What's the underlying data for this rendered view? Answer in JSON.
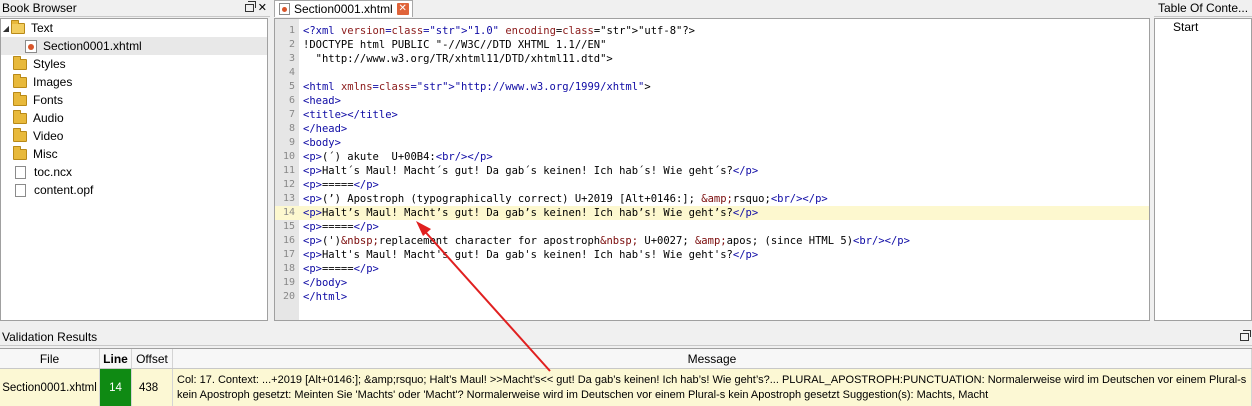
{
  "book_browser": {
    "title": "Book Browser",
    "items": [
      {
        "label": "Text",
        "kind": "folder-open"
      },
      {
        "label": "Section0001.xhtml",
        "kind": "xhtml-file"
      },
      {
        "label": "Styles",
        "kind": "folder"
      },
      {
        "label": "Images",
        "kind": "folder"
      },
      {
        "label": "Fonts",
        "kind": "folder"
      },
      {
        "label": "Audio",
        "kind": "folder"
      },
      {
        "label": "Video",
        "kind": "folder"
      },
      {
        "label": "Misc",
        "kind": "folder"
      },
      {
        "label": "toc.ncx",
        "kind": "file"
      },
      {
        "label": "content.opf",
        "kind": "file"
      }
    ]
  },
  "editor": {
    "tab_label": "Section0001.xhtml",
    "current_line": 14,
    "lines": [
      "<?xml version=\"1.0\" encoding=\"utf-8\"?>",
      "<!DOCTYPE html PUBLIC \"-//W3C//DTD XHTML 1.1//EN\"",
      "  \"http://www.w3.org/TR/xhtml11/DTD/xhtml11.dtd\">",
      "",
      "<html xmlns=\"http://www.w3.org/1999/xhtml\">",
      "<head>",
      "<title></title>",
      "</head>",
      "<body>",
      "<p>(´) akute  U+00B4:<br/></p>",
      "<p>Halt´s Maul! Macht´s gut! Da gab´s keinen! Ich hab´s! Wie geht´s?</p>",
      "<p>=====</p>",
      "<p>(’) Apostroph (typographically correct) U+2019 [Alt+0146:]; &amp;rsquo;<br/></p>",
      "<p>Halt’s Maul! Macht’s gut! Da gab’s keinen! Ich hab’s! Wie geht’s?</p>",
      "<p>=====</p>",
      "<p>(')&nbsp;replacement character for apostroph&nbsp; U+0027; &amp;apos; (since HTML 5)<br/></p>",
      "<p>Halt's Maul! Macht's gut! Da gab's keinen! Ich hab's! Wie geht's?</p>",
      "<p>=====</p>",
      "</body>",
      "</html>"
    ]
  },
  "toc": {
    "title": "Table Of Conte...",
    "items": [
      "Start"
    ]
  },
  "validation": {
    "title": "Validation Results",
    "columns": [
      "File",
      "Line",
      "Offset",
      "Message"
    ],
    "rows": [
      {
        "file": "Section0001.xhtml",
        "line": "14",
        "offset": "438",
        "message": "Col: 17. Context: ...+2019 [Alt+0146:]; &amp;rsquo;  Halt’s Maul! >>Macht’s<< gut! Da gab’s keinen! Ich hab’s! Wie geht’s?... PLURAL_APOSTROPH:PUNCTUATION: Normalerweise wird im Deutschen vor einem Plural-s kein Apostroph gesetzt: Meinten Sie 'Machts' oder 'Macht'? Normalerweise wird im Deutschen vor einem Plural-s kein Apostroph gesetzt Suggestion(s): Machts, Macht"
      }
    ]
  },
  "colors": {
    "line_badge": "#0f8a13",
    "highlight_row": "#fcf8d4",
    "annotation_arrow": "#e02020"
  }
}
